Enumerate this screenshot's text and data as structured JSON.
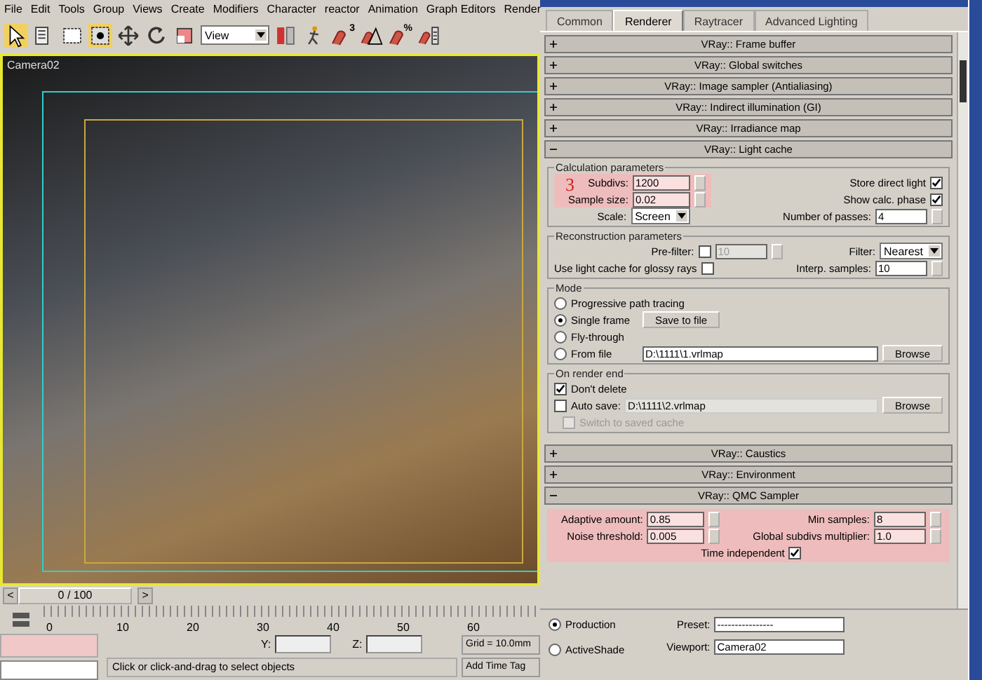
{
  "menu": [
    {
      "label": "File"
    },
    {
      "label": "Edit"
    },
    {
      "label": "Tools"
    },
    {
      "label": "Group"
    },
    {
      "label": "Views"
    },
    {
      "label": "Create"
    },
    {
      "label": "Modifiers"
    },
    {
      "label": "Character"
    },
    {
      "label": "reactor"
    },
    {
      "label": "Animation"
    },
    {
      "label": "Graph Editors"
    },
    {
      "label": "Render"
    }
  ],
  "toolbar": {
    "view_dropdown": "View",
    "snap_badges": [
      "3",
      "%"
    ]
  },
  "viewport": {
    "label": "Camera02"
  },
  "time_slider": {
    "prev": "<",
    "position": "0 / 100",
    "next": ">"
  },
  "timeline": {
    "ticks": [
      "0",
      "10",
      "20",
      "30",
      "40",
      "50",
      "60"
    ]
  },
  "status_bar": {
    "y_label": "Y:",
    "z_label": "Z:",
    "grid": "Grid = 10.0mm",
    "prompt": "Click or click-and-drag to select objects",
    "time_tag": "Add Time Tag"
  },
  "render_dialog": {
    "tabs": [
      {
        "label": "Common",
        "selected": false
      },
      {
        "label": "Renderer",
        "selected": true
      },
      {
        "label": "Raytracer",
        "selected": false
      },
      {
        "label": "Advanced Lighting",
        "selected": false
      }
    ],
    "rollouts": [
      {
        "title": "VRay:: Frame buffer",
        "expanded": false,
        "kind": "plain"
      },
      {
        "title": "VRay:: Global switches",
        "expanded": false,
        "kind": "plain"
      },
      {
        "title": "VRay:: Image sampler (Antialiasing)",
        "expanded": false,
        "kind": "plain"
      },
      {
        "title": "VRay:: Indirect illumination (GI)",
        "expanded": false,
        "kind": "plain"
      },
      {
        "title": "VRay:: Irradiance map",
        "expanded": false,
        "kind": "plain"
      },
      {
        "title": "VRay:: Light cache",
        "expanded": true,
        "kind": "light_cache"
      },
      {
        "title": "VRay:: Caustics",
        "expanded": false,
        "kind": "plain"
      },
      {
        "title": "VRay:: Environment",
        "expanded": false,
        "kind": "plain"
      },
      {
        "title": "VRay:: QMC Sampler",
        "expanded": true,
        "kind": "qmc"
      }
    ],
    "light_cache": {
      "calc_title": "Calculation parameters",
      "annotation": "3",
      "subdivs_label": "Subdivs:",
      "subdivs": "1200",
      "sample_size_label": "Sample size:",
      "sample_size": "0.02",
      "scale_label": "Scale:",
      "scale": "Screen",
      "store_direct_label": "Store direct light",
      "store_direct": true,
      "show_calc_label": "Show calc. phase",
      "show_calc": true,
      "passes_label": "Number of passes:",
      "passes": "4",
      "recon_title": "Reconstruction parameters",
      "prefilter_label": "Pre-filter:",
      "prefilter": false,
      "prefilter_value": "10",
      "glossy_label": "Use light cache for glossy rays",
      "glossy": false,
      "filter_label": "Filter:",
      "filter": "Nearest",
      "interp_label": "Interp. samples:",
      "interp": "10",
      "mode_title": "Mode",
      "modes": [
        {
          "label": "Progressive path tracing",
          "selected": false
        },
        {
          "label": "Single frame",
          "selected": true
        },
        {
          "label": "Fly-through",
          "selected": false
        },
        {
          "label": "From file",
          "selected": false
        }
      ],
      "save_button": "Save to file",
      "from_file": "D:\\1111\\1.vrlmap",
      "browse": "Browse",
      "end_title": "On render end",
      "dont_delete_label": "Don't delete",
      "dont_delete": true,
      "auto_save_label": "Auto save:",
      "auto_save": false,
      "auto_save_file": "D:\\1111\\2.vrlmap",
      "browse2": "Browse",
      "switch_label": "Switch to saved cache",
      "switch": false
    },
    "qmc": {
      "adaptive_label": "Adaptive amount:",
      "adaptive": "0.85",
      "noise_label": "Noise threshold:",
      "noise": "0.005",
      "min_label": "Min samples:",
      "min": "8",
      "global_label": "Global subdivs multiplier:",
      "global": "1.0",
      "time_label": "Time independent",
      "time_independent": true
    },
    "bottom": {
      "targets": [
        {
          "label": "Production",
          "selected": true
        },
        {
          "label": "ActiveShade",
          "selected": false
        }
      ],
      "preset_label": "Preset:",
      "preset": "----------------",
      "viewport_label": "Viewport:",
      "viewport": "Camera02"
    }
  }
}
